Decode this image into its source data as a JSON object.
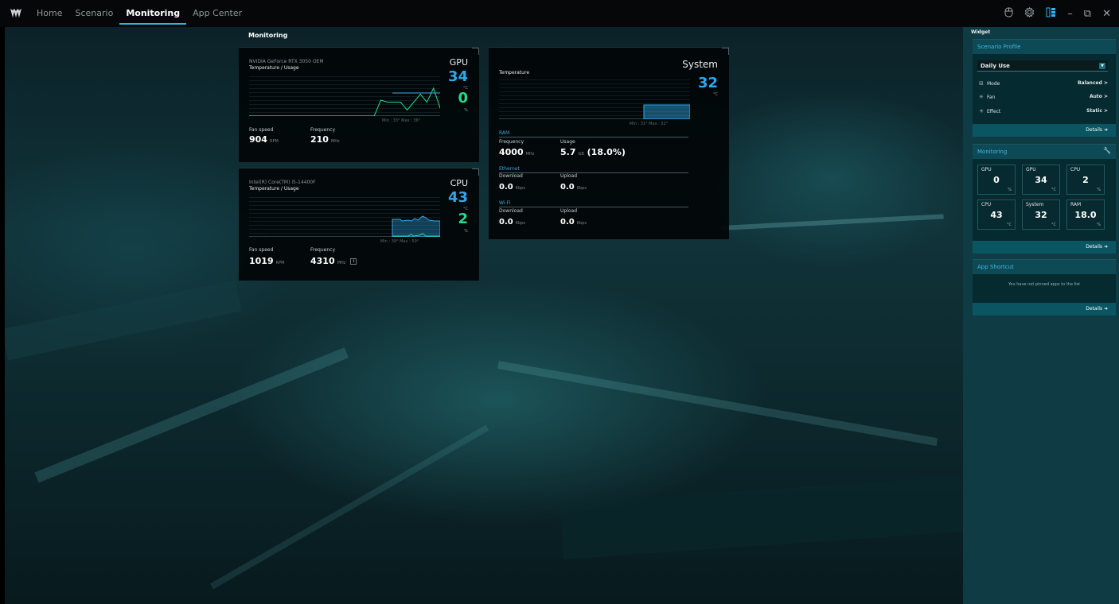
{
  "topbar": {
    "nav": [
      "Home",
      "Scenario",
      "Monitoring",
      "App Center"
    ],
    "active_index": 2,
    "window_controls": [
      "minimize",
      "restore",
      "close"
    ]
  },
  "main": {
    "title": "Monitoring",
    "gpu_card": {
      "device": "NVIDIA GeForce RTX 3050 OEM",
      "subtitle": "Temperature / Usage",
      "label": "GPU",
      "temp": "34",
      "temp_unit": "°C",
      "usage": "0",
      "usage_unit": "%",
      "minmax": "Min : 33°   Max : 36°",
      "fan_label": "Fan speed",
      "fan_value": "904",
      "fan_unit": "RPM",
      "freq_label": "Frequency",
      "freq_value": "210",
      "freq_unit": "MHz",
      "temp_level": 0.34,
      "usage_history": [
        0,
        0,
        0,
        0,
        0,
        0,
        0,
        0,
        0,
        0,
        0,
        0,
        0,
        0,
        0,
        0,
        0,
        0,
        0,
        0,
        0.4,
        0.35,
        0.35,
        0.35,
        0.15,
        0.35,
        0.55,
        0.35,
        0.7,
        0.2
      ]
    },
    "cpu_card": {
      "device": "Intel(R) Core(TM) i5-14400F",
      "subtitle": "Temperature / Usage",
      "label": "CPU",
      "temp": "43",
      "temp_unit": "°C",
      "usage": "2",
      "usage_unit": "%",
      "minmax": "Min : 39°   Max : 59°",
      "fan_label": "Fan speed",
      "fan_value": "1019",
      "fan_unit": "RPM",
      "freq_label": "Frequency",
      "freq_value": "4310",
      "freq_unit": "MHz",
      "temp_level": 0.43,
      "info_icon": "info-icon"
    },
    "system_card": {
      "label": "System",
      "temp_title": "Temperature",
      "temp": "32",
      "temp_unit": "°C",
      "minmax": "Min : 31°   Max : 32°",
      "temp_level": 0.32,
      "ram": {
        "group": "RAM",
        "freq_label": "Frequency",
        "freq_value": "4000",
        "freq_unit": "MHz",
        "usage_label": "Usage",
        "usage_value": "5.7",
        "usage_unit": "GB",
        "usage_pct": "(18.0%)"
      },
      "ethernet": {
        "group": "Ethernet",
        "down_label": "Download",
        "down_value": "0.0",
        "down_unit": "Kbps",
        "up_label": "Upload",
        "up_value": "0.0",
        "up_unit": "Kbps"
      },
      "wifi": {
        "group": "Wi-Fi",
        "down_label": "Download",
        "down_value": "0.0",
        "down_unit": "Kbps",
        "up_label": "Upload",
        "up_value": "0.0",
        "up_unit": "Kbps"
      }
    }
  },
  "widget": {
    "title": "Widget",
    "scenario": {
      "head": "Scenario Profile",
      "profile": "Daily Use",
      "rows": [
        {
          "icon": "mode-icon",
          "label": "Mode",
          "value": "Balanced >"
        },
        {
          "icon": "fan-icon",
          "label": "Fan",
          "value": "Auto >"
        },
        {
          "icon": "effect-icon",
          "label": "Effect",
          "value": "Static >"
        }
      ],
      "details": "Details ➔"
    },
    "monitoring": {
      "head": "Monitoring",
      "cells": [
        {
          "label": "GPU",
          "value": "0",
          "unit": "%"
        },
        {
          "label": "GPU",
          "value": "34",
          "unit": "°C"
        },
        {
          "label": "CPU",
          "value": "2",
          "unit": "%"
        },
        {
          "label": "CPU",
          "value": "43",
          "unit": "°C"
        },
        {
          "label": "System",
          "value": "32",
          "unit": "°C"
        },
        {
          "label": "RAM",
          "value": "18.0",
          "unit": "%"
        }
      ],
      "details": "Details ➔"
    },
    "shortcut": {
      "head": "App Shortcut",
      "empty": "You have not pinned apps to the list",
      "details": "Details ➔"
    }
  },
  "colors": {
    "accent_blue": "#2ea8ea",
    "accent_green": "#27d98d",
    "panel_bg": "#0f3c44"
  }
}
